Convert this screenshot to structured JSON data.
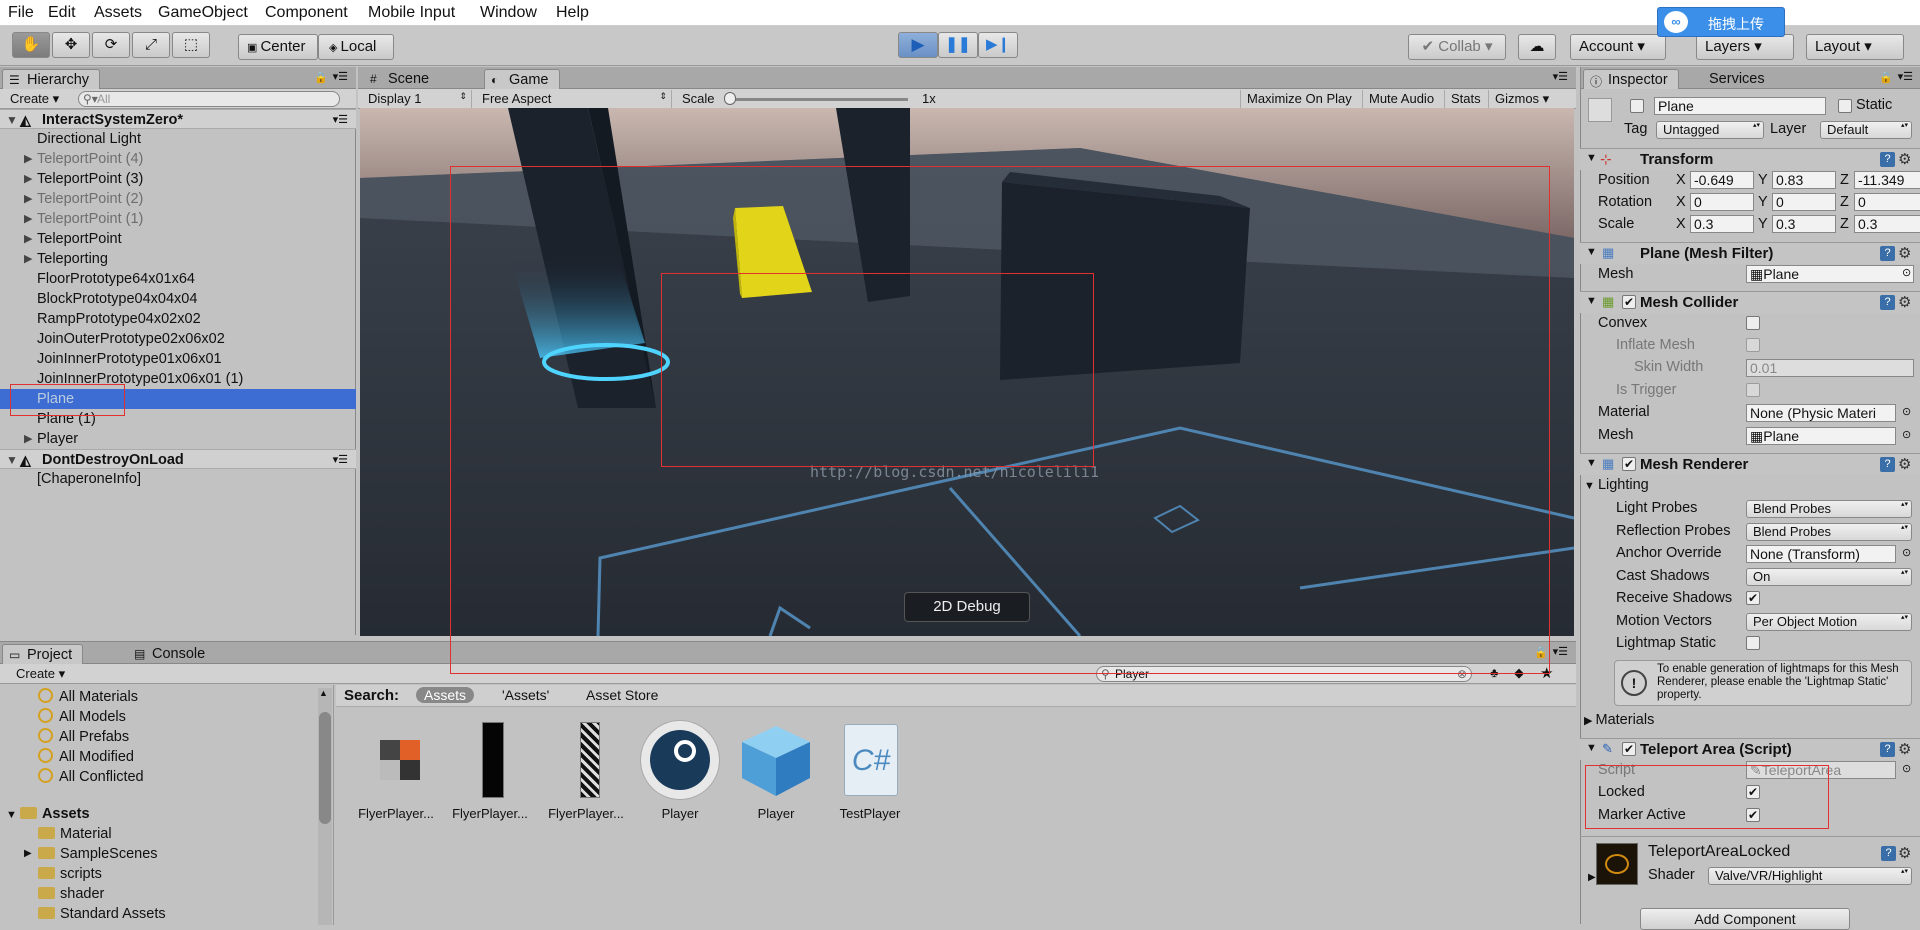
{
  "menu": [
    "File",
    "Edit",
    "Assets",
    "GameObject",
    "Component",
    "Mobile Input",
    "Window",
    "Help"
  ],
  "cloud_upload": {
    "label": "拖拽上传",
    "icon": "cloud-icon"
  },
  "toolbar": {
    "center": "Center",
    "local": "Local",
    "collab": "Collab",
    "account": "Account",
    "layers": "Layers",
    "layout": "Layout",
    "tools": [
      "hand-icon",
      "move-icon",
      "rotate-icon",
      "scale-icon",
      "rect-tool-icon"
    ],
    "play": [
      "play-icon",
      "pause-icon",
      "step-icon"
    ]
  },
  "hierarchy": {
    "tab": "Hierarchy",
    "create": "Create",
    "search_placeholder": "All",
    "scene": "InteractSystemZero*",
    "items": [
      {
        "label": "Directional Light",
        "arrow": false,
        "dim": false
      },
      {
        "label": "TeleportPoint (4)",
        "arrow": true,
        "dim": true
      },
      {
        "label": "TeleportPoint (3)",
        "arrow": true,
        "dim": false
      },
      {
        "label": "TeleportPoint (2)",
        "arrow": true,
        "dim": true
      },
      {
        "label": "TeleportPoint (1)",
        "arrow": true,
        "dim": true
      },
      {
        "label": "TeleportPoint",
        "arrow": true,
        "dim": false
      },
      {
        "label": "Teleporting",
        "arrow": true,
        "dim": false
      },
      {
        "label": "FloorPrototype64x01x64",
        "arrow": false,
        "dim": false
      },
      {
        "label": "BlockPrototype04x04x04",
        "arrow": false,
        "dim": false
      },
      {
        "label": "RampPrototype04x02x02",
        "arrow": false,
        "dim": false
      },
      {
        "label": "JoinOuterPrototype02x06x02",
        "arrow": false,
        "dim": false
      },
      {
        "label": "JoinInnerPrototype01x06x01",
        "arrow": false,
        "dim": false
      },
      {
        "label": "JoinInnerPrototype01x06x01 (1)",
        "arrow": false,
        "dim": false
      },
      {
        "label": "Plane",
        "arrow": false,
        "dim": false,
        "selected": true
      },
      {
        "label": "Plane (1)",
        "arrow": false,
        "dim": false
      },
      {
        "label": "Player",
        "arrow": true,
        "dim": false
      }
    ],
    "scene2": "DontDestroyOnLoad",
    "items2": [
      "[ChaperoneInfo]"
    ]
  },
  "game": {
    "tab_scene": "Scene",
    "tab_game": "Game",
    "display": "Display 1",
    "aspect": "Free Aspect",
    "scale_label": "Scale",
    "scale_value": "1x",
    "toggles": [
      "Maximize On Play",
      "Mute Audio",
      "Stats",
      "Gizmos"
    ],
    "debug_button": "2D Debug",
    "watermark": "http://blog.csdn.net/nicolelili1"
  },
  "inspector": {
    "tab": "Inspector",
    "tab2": "Services",
    "name": "Plane",
    "static": "Static",
    "tag_label": "Tag",
    "tag": "Untagged",
    "layer_label": "Layer",
    "layer": "Default",
    "transform": {
      "title": "Transform",
      "position": {
        "label": "Position",
        "x": "-0.649",
        "y": "0.83",
        "z": "-11.349"
      },
      "rotation": {
        "label": "Rotation",
        "x": "0",
        "y": "0",
        "z": "0"
      },
      "scale": {
        "label": "Scale",
        "x": "0.3",
        "y": "0.3",
        "z": "0.3"
      }
    },
    "mesh_filter": {
      "title": "Plane (Mesh Filter)",
      "mesh_label": "Mesh",
      "mesh": "Plane"
    },
    "mesh_collider": {
      "title": "Mesh Collider",
      "convex": "Convex",
      "inflate": "Inflate Mesh",
      "skin": "Skin Width",
      "skin_val": "0.01",
      "trigger": "Is Trigger",
      "material_label": "Material",
      "material": "None (Physic Materi",
      "mesh_label": "Mesh",
      "mesh": "Plane"
    },
    "mesh_renderer": {
      "title": "Mesh Renderer",
      "lighting": "Lighting",
      "light_probes_label": "Light Probes",
      "light_probes": "Blend Probes",
      "refl_label": "Reflection Probes",
      "refl": "Blend Probes",
      "anchor_label": "Anchor Override",
      "anchor": "None (Transform)",
      "cast_label": "Cast Shadows",
      "cast": "On",
      "receive_label": "Receive Shadows",
      "motion_label": "Motion Vectors",
      "motion": "Per Object Motion",
      "lightmap_label": "Lightmap Static",
      "info": "To enable generation of lightmaps for this Mesh Renderer, please enable the 'Lightmap Static' property."
    },
    "materials": "Materials",
    "teleport_area": {
      "title": "Teleport Area (Script)",
      "script_label": "Script",
      "script": "TeleportArea",
      "locked": "Locked",
      "marker": "Marker Active"
    },
    "material_asset": {
      "name": "TeleportAreaLocked",
      "shader_label": "Shader",
      "shader": "Valve/VR/Highlight"
    },
    "add_component": "Add Component"
  },
  "project": {
    "tab": "Project",
    "tab2": "Console",
    "create": "Create",
    "search_value": "Player",
    "favorites": [
      "All Materials",
      "All Models",
      "All Prefabs",
      "All Modified",
      "All Conflicted"
    ],
    "assets_root": "Assets",
    "folders": [
      {
        "label": "Material",
        "arrow": false
      },
      {
        "label": "SampleScenes",
        "arrow": true
      },
      {
        "label": "scripts",
        "arrow": false
      },
      {
        "label": "shader",
        "arrow": false
      },
      {
        "label": "Standard Assets",
        "arrow": false
      }
    ],
    "search_label": "Search:",
    "scopes": [
      "Assets",
      "'Assets'",
      "Asset Store"
    ],
    "results": [
      "FlyerPlayer...",
      "FlyerPlayer...",
      "FlyerPlayer...",
      "Player",
      "Player",
      "TestPlayer"
    ]
  },
  "colors": {
    "selection": "#3d6cd3",
    "annotation": "#e23030",
    "play_blue": "#2a7ad8"
  }
}
